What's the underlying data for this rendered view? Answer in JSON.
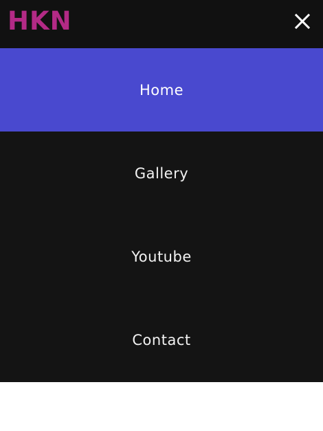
{
  "header": {
    "logo_text": "HKN",
    "close_icon": "close-icon"
  },
  "menu": {
    "items": [
      {
        "label": "Home",
        "active": true
      },
      {
        "label": "Gallery",
        "active": false
      },
      {
        "label": "Youtube",
        "active": false
      },
      {
        "label": "Contact",
        "active": false
      }
    ]
  },
  "colors": {
    "header_bg": "#111111",
    "menu_bg": "#141414",
    "active_bg": "#4949cf",
    "logo": "#b32a86",
    "text": "#f2f2f2",
    "page_bg": "#ffffff"
  }
}
